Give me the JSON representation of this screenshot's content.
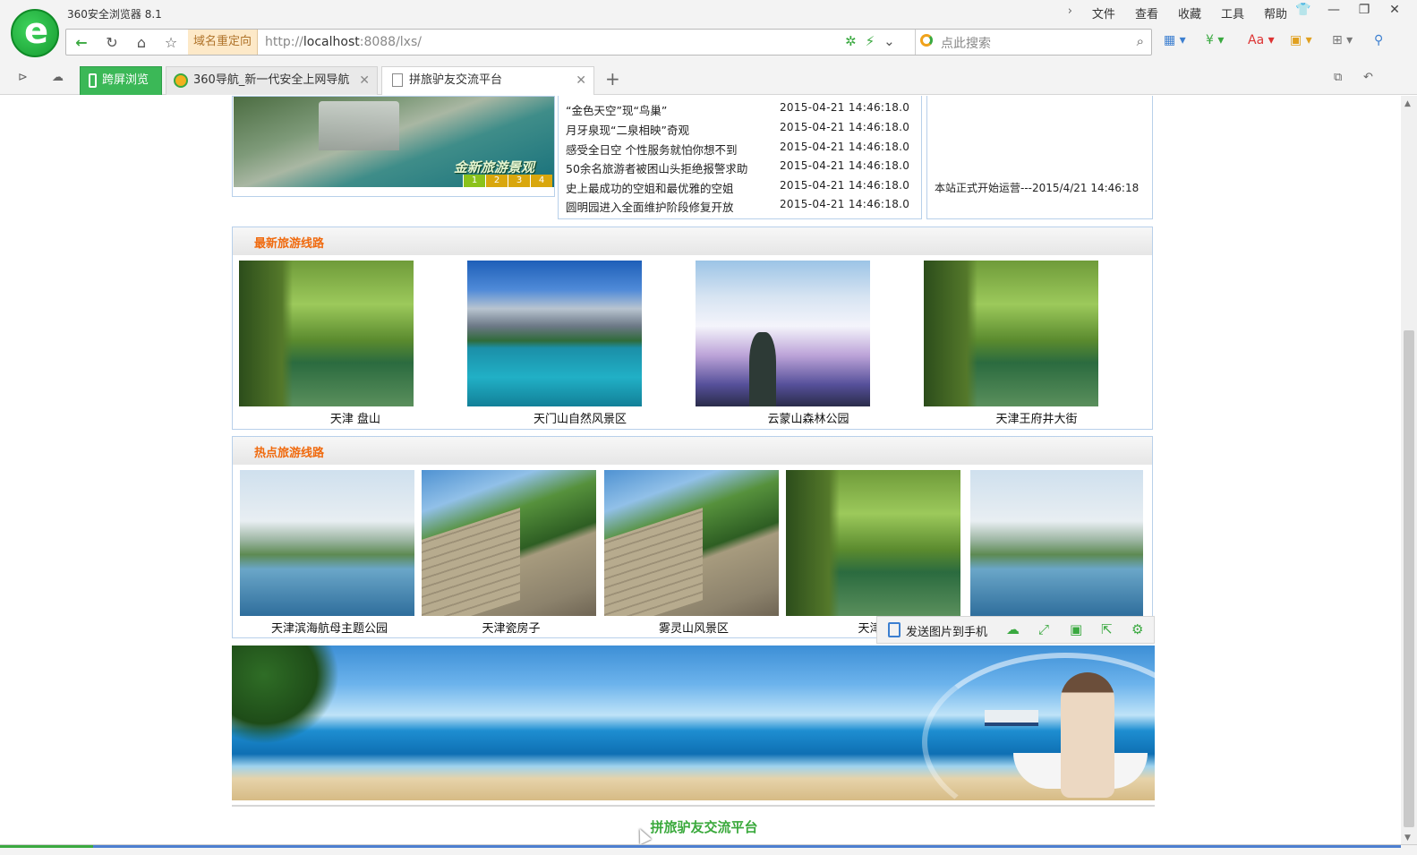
{
  "browser": {
    "app_title": "360安全浏览器 8.1",
    "menu": [
      "文件",
      "查看",
      "收藏",
      "工具",
      "帮助"
    ],
    "redirect_label": "域名重定向",
    "url_prefix": "http://",
    "url_host": "localhost",
    "url_rest": ":8088/lxs/",
    "search_placeholder": "点此搜索",
    "tabs": [
      {
        "label": "跨屏浏览"
      },
      {
        "label": "360导航_新一代安全上网导航"
      },
      {
        "label": "拼旅驴友交流平台"
      }
    ]
  },
  "banner": {
    "caption": "金新旅游景观",
    "pages": [
      "1",
      "2",
      "3",
      "4"
    ]
  },
  "news": [
    {
      "title": "“金色天空”现“鸟巢”",
      "date": "2015-04-21 14:46:18.0"
    },
    {
      "title": "月牙泉现“二泉相映”奇观",
      "date": "2015-04-21 14:46:18.0"
    },
    {
      "title": "感受全日空 个性服务就怕你想不到",
      "date": "2015-04-21 14:46:18.0"
    },
    {
      "title": "50余名旅游者被困山头拒绝报警求助",
      "date": "2015-04-21 14:46:18.0"
    },
    {
      "title": "史上最成功的空姐和最优雅的空姐",
      "date": "2015-04-21 14:46:18.0"
    },
    {
      "title": "圆明园进入全面维护阶段修复开放",
      "date": "2015-04-21 14:46:18.0"
    }
  ],
  "notice": "本站正式开始运营---2015/4/21 14:46:18",
  "latest_routes": {
    "title": "最新旅游线路",
    "items": [
      {
        "name": "天津 盘山",
        "scene": "river"
      },
      {
        "name": "天门山自然风景区",
        "scene": "lake"
      },
      {
        "name": "云蒙山森林公园",
        "scene": "clouds"
      },
      {
        "name": "天津王府井大街",
        "scene": "river"
      }
    ]
  },
  "hot_routes": {
    "title": "热点旅游线路",
    "items": [
      {
        "name": "天津滨海航母主题公园",
        "scene": "karst"
      },
      {
        "name": "天津瓷房子",
        "scene": "wall"
      },
      {
        "name": "雾灵山风景区",
        "scene": "wall"
      },
      {
        "name": "天津古",
        "scene": "river"
      },
      {
        "name": "",
        "scene": "karst"
      }
    ]
  },
  "image_toolbar": {
    "send_label": "发送图片到手机"
  },
  "footer": "拼旅驴友交流平台"
}
